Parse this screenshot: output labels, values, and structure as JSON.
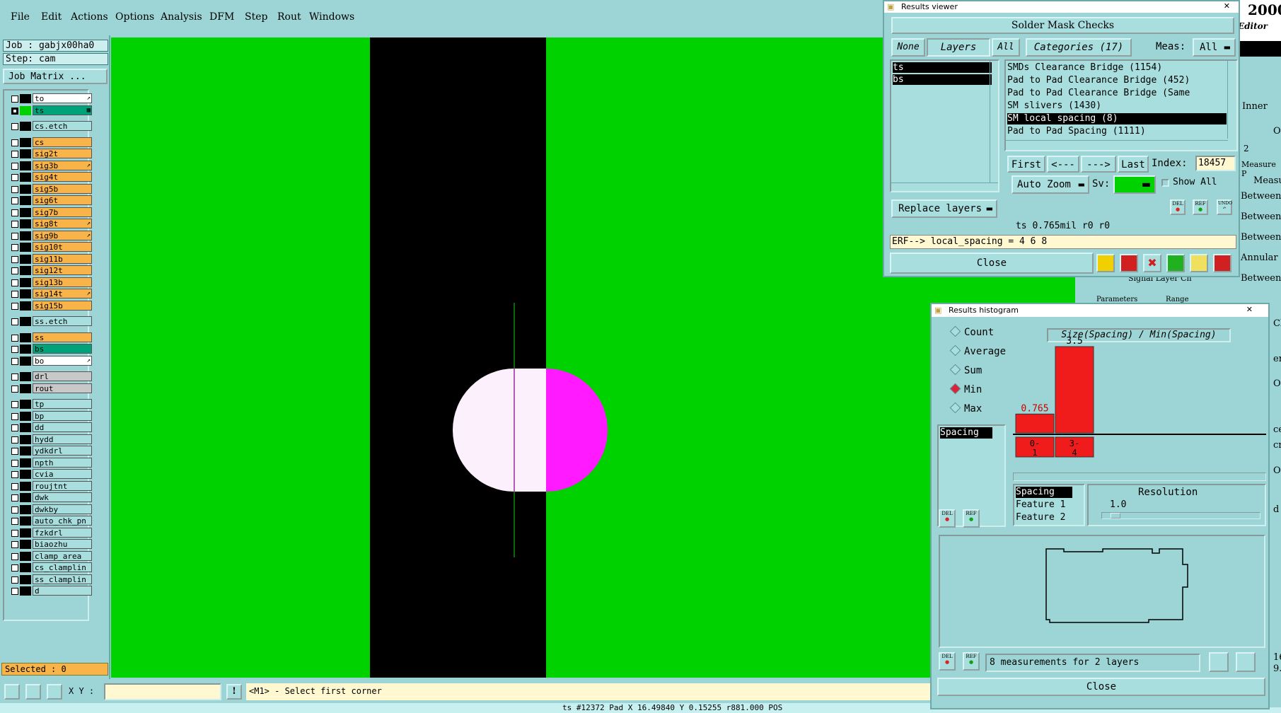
{
  "menubar": {
    "items": [
      "File",
      "Edit",
      "Actions",
      "Options",
      "Analysis",
      "DFM",
      "Step",
      "Rout",
      "Windows"
    ]
  },
  "job": {
    "job_label": "Job : gabjx00ha0",
    "step_label": "Step: cam",
    "matrix_button": "Job Matrix ..."
  },
  "layers": [
    {
      "name": "to",
      "color": "#ffffff",
      "flag": "↗"
    },
    {
      "name": "ts",
      "color": "#00a27a",
      "flag": "▦"
    },
    {
      "name": "cs.etch",
      "color": "#a9dede",
      "flag": ""
    },
    {
      "name": "cs",
      "color": "#f8b448",
      "flag": ""
    },
    {
      "name": "sig2t",
      "color": "#f8b448",
      "flag": ""
    },
    {
      "name": "sig3b",
      "color": "#f8b448",
      "flag": "↗"
    },
    {
      "name": "sig4t",
      "color": "#f8b448",
      "flag": ""
    },
    {
      "name": "sig5b",
      "color": "#f8b448",
      "flag": ""
    },
    {
      "name": "sig6t",
      "color": "#f8b448",
      "flag": ""
    },
    {
      "name": "sig7b",
      "color": "#f8b448",
      "flag": ""
    },
    {
      "name": "sig8t",
      "color": "#f8b448",
      "flag": "↗"
    },
    {
      "name": "sig9b",
      "color": "#f8b448",
      "flag": "↗"
    },
    {
      "name": "sig10t",
      "color": "#f8b448",
      "flag": ""
    },
    {
      "name": "sig11b",
      "color": "#f8b448",
      "flag": ""
    },
    {
      "name": "sig12t",
      "color": "#f8b448",
      "flag": ""
    },
    {
      "name": "sig13b",
      "color": "#f8b448",
      "flag": ""
    },
    {
      "name": "sig14t",
      "color": "#f8b448",
      "flag": "↗"
    },
    {
      "name": "sig15b",
      "color": "#f8b448",
      "flag": ""
    },
    {
      "name": "ss.etch",
      "color": "#a9dede",
      "flag": ""
    },
    {
      "name": "ss",
      "color": "#f8b448",
      "flag": ""
    },
    {
      "name": "bs",
      "color": "#00a27a",
      "flag": ""
    },
    {
      "name": "bo",
      "color": "#ffffff",
      "flag": "↗"
    },
    {
      "name": "drl",
      "color": "#c8c8c8",
      "flag": ""
    },
    {
      "name": "rout",
      "color": "#c8c8c8",
      "flag": ""
    },
    {
      "name": "tp",
      "color": "#a9dede",
      "flag": ""
    },
    {
      "name": "bp",
      "color": "#a9dede",
      "flag": ""
    },
    {
      "name": "dd",
      "color": "#a9dede",
      "flag": ""
    },
    {
      "name": "hydd",
      "color": "#a9dede",
      "flag": ""
    },
    {
      "name": "ydkdrl",
      "color": "#a9dede",
      "flag": ""
    },
    {
      "name": "npth",
      "color": "#a9dede",
      "flag": ""
    },
    {
      "name": "cvia",
      "color": "#a9dede",
      "flag": ""
    },
    {
      "name": "roujtnt",
      "color": "#a9dede",
      "flag": ""
    },
    {
      "name": "dwk",
      "color": "#a9dede",
      "flag": ""
    },
    {
      "name": "dwkby",
      "color": "#a9dede",
      "flag": ""
    },
    {
      "name": "auto_chk_pn",
      "color": "#a9dede",
      "flag": ""
    },
    {
      "name": "fzkdrl",
      "color": "#a9dede",
      "flag": ""
    },
    {
      "name": "biaozhu",
      "color": "#a9dede",
      "flag": ""
    },
    {
      "name": "clamp_area",
      "color": "#a9dede",
      "flag": ""
    },
    {
      "name": "cs_clamplin",
      "color": "#a9dede",
      "flag": ""
    },
    {
      "name": "ss_clamplin",
      "color": "#a9dede",
      "flag": ""
    },
    {
      "name": "d",
      "color": "#a9dede",
      "flag": ""
    }
  ],
  "left_footer": {
    "selected": "Selected : 0"
  },
  "bottom": {
    "xy_label": "X Y :",
    "prompt": "<M1> - Select first corner",
    "statusline": "ts #12372 Pad X 16.49840 Y 0.15255 r881.000 POS"
  },
  "results_viewer": {
    "window_title": "Results viewer",
    "title": "Solder Mask Checks",
    "none_btn": "None",
    "layers_btn": "Layers",
    "all_btn": "All",
    "categories_btn": "Categories (17)",
    "meas_label": "Meas:",
    "meas_value": "All",
    "layer_list": [
      "ts",
      "bs"
    ],
    "categories": [
      "SMDs Clearance Bridge (1154)",
      "Pad to Pad Clearance Bridge (452)",
      "Pad to Pad Clearance Bridge (Same",
      "SM slivers (1430)",
      "SM local spacing (8)",
      "Pad to Pad Spacing (1111)"
    ],
    "selected_category_index": 4,
    "first_btn": "First",
    "prev_btn": "<---",
    "next_btn": "--->",
    "last_btn": "Last",
    "index_label": "Index:",
    "index_value": "18457",
    "auto_zoom": "Auto Zoom",
    "sv_label": "Sv:",
    "show_all": "Show All",
    "replace_layers": "Replace layers",
    "del_label": "DEL",
    "ref_label": "REF",
    "undo_label": "UNDO",
    "measure_info": "ts 0.765mil   r0   r0",
    "erf_text": "ERF--> local_spacing = 4 6 8",
    "close": "Close"
  },
  "histogram": {
    "window_title": "Results histogram",
    "modes": [
      "Count",
      "Average",
      "Sum",
      "Min",
      "Max"
    ],
    "selected_mode": "Min",
    "attr_list": [
      "Spacing"
    ],
    "chart_title": "Size(Spacing) / Min(Spacing)",
    "bars": [
      {
        "bin": "0-\n1",
        "value": 0.765,
        "label": "0.765"
      },
      {
        "bin": "3-\n4",
        "value": 3.5,
        "label": "3.5"
      }
    ],
    "size_list": [
      "Spacing",
      "Feature 1",
      "Feature 2"
    ],
    "resolution_label": "Resolution",
    "resolution_value": "1.0",
    "summary": "8 measurements for 2 layers",
    "del_label": "DEL",
    "ref_label": "REF",
    "close": "Close"
  },
  "behind_window": {
    "year": "2000",
    "editor": "Editor",
    "inner": "Inner",
    "o": "O",
    "two": "2",
    "measure": "Measure P",
    "measu": "Measu",
    "between": [
      "Between",
      "Between",
      "Between",
      "Annular",
      "Between"
    ],
    "signal": "Signal Layer Ch",
    "param": "Parameters",
    "range": "Range",
    "cl": "Cl",
    "er": "er",
    "ce": "ce",
    "cr": "cr",
    "d": "d",
    "num1": "16",
    "num2": "9."
  },
  "colors": {
    "canvas_bg": "#00d200",
    "copper": "#000000",
    "pad_white": "#fbf0fb",
    "pad_magenta": "#ff1aff",
    "hist_bar": "#f01c1c"
  }
}
